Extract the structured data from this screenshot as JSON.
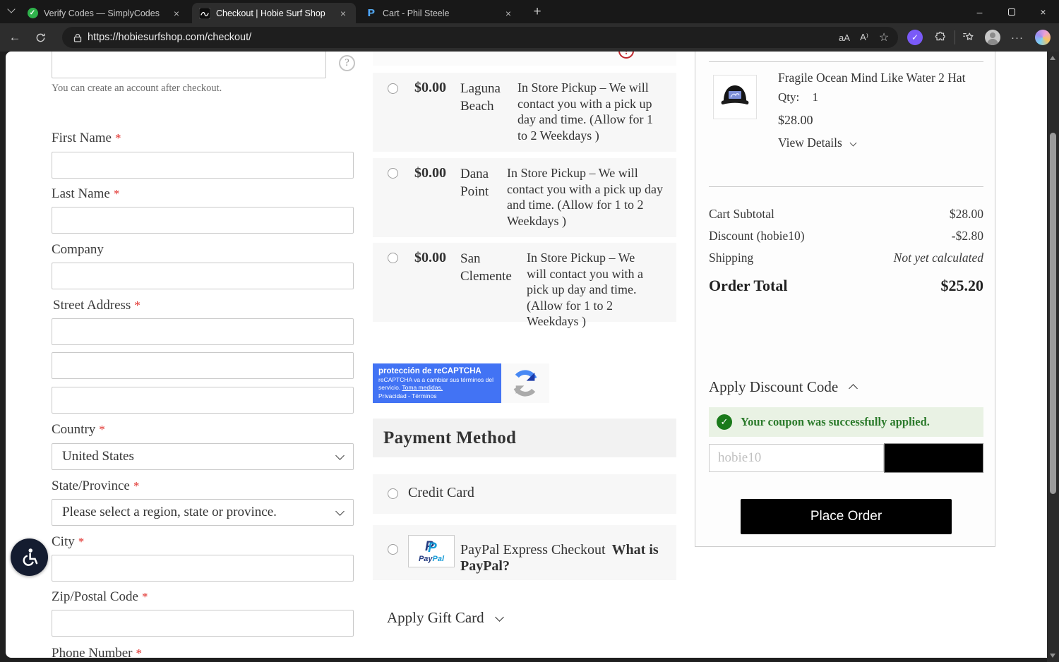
{
  "browser": {
    "tabs": [
      {
        "title": "Verify Codes — SimplyCodes"
      },
      {
        "title": "Checkout | Hobie Surf Shop"
      },
      {
        "title": "Cart - Phil Steele"
      }
    ],
    "url": "https://hobiesurfshop.com/checkout/"
  },
  "icons": {
    "back": "←",
    "star": "☆",
    "close": "×",
    "minimize": "–",
    "more": "···",
    "new_tab": "+",
    "help": "?",
    "check": "✓",
    "translate": "aA",
    "read_aloud": "A⁾",
    "error": "!"
  },
  "account": {
    "helper": "You can create an account after checkout."
  },
  "form": {
    "required_mark": "*",
    "first_name": {
      "label": "First Name"
    },
    "last_name": {
      "label": "Last Name"
    },
    "company": {
      "label": "Company"
    },
    "street": {
      "label": "Street Address"
    },
    "country": {
      "label": "Country",
      "value": "United States"
    },
    "state": {
      "label": "State/Province",
      "value": "Please select a region, state or province."
    },
    "city": {
      "label": "City"
    },
    "zip": {
      "label": "Zip/Postal Code"
    },
    "phone": {
      "label": "Phone Number"
    }
  },
  "shipping": {
    "options": [
      {
        "price": "$0.00",
        "location": "Laguna Beach",
        "description": "In Store Pickup – We will contact you with a pick up day and time. (Allow for 1 to 2 Weekdays )"
      },
      {
        "price": "$0.00",
        "location": "Dana Point",
        "description": "In Store Pickup – We will contact you with a pick up day and time. (Allow for 1 to 2 Weekdays )"
      },
      {
        "price": "$0.00",
        "location": "San Clemente",
        "description": "In Store Pickup – We will contact you with a pick up day and time. (Allow for 1 to 2 Weekdays )"
      }
    ]
  },
  "recaptcha": {
    "title": "protección de reCAPTCHA",
    "body": "reCAPTCHA va a cambiar sus términos del servicio. ",
    "link": "Toma medidas.",
    "footer": "Privacidad - Términos"
  },
  "payment": {
    "title": "Payment Method",
    "credit_card": "Credit Card",
    "paypal": "PayPal Express Checkout",
    "paypal_link": "What is PayPal?",
    "paypal_word_1": "Pay",
    "paypal_word_2": "Pal",
    "paypal_letter": "P"
  },
  "gift_card": {
    "label": "Apply Gift Card"
  },
  "summary": {
    "product": {
      "name": "Fragile Ocean Mind Like Water 2 Hat",
      "qty_label": "Qty:",
      "qty": "1",
      "price": "$28.00",
      "view_details": "View Details"
    },
    "rows": [
      {
        "label": "Cart Subtotal",
        "value": "$28.00"
      },
      {
        "label": "Discount (hobie10)",
        "value": "-$2.80"
      },
      {
        "label": "Shipping",
        "value": "Not yet calculated"
      }
    ],
    "total_label": "Order Total",
    "total_value": "$25.20",
    "discount": {
      "title": "Apply Discount Code",
      "success": "Your coupon was successfully applied.",
      "placeholder": "hobie10"
    },
    "place_order": "Place Order"
  },
  "colors": {
    "accent_black": "#000000",
    "success_green": "#1a7a1a",
    "success_bg": "#e9f2e4",
    "recaptcha_blue": "#4273f4",
    "required_red": "#e02b27",
    "row_gray": "#f7f7f7"
  }
}
